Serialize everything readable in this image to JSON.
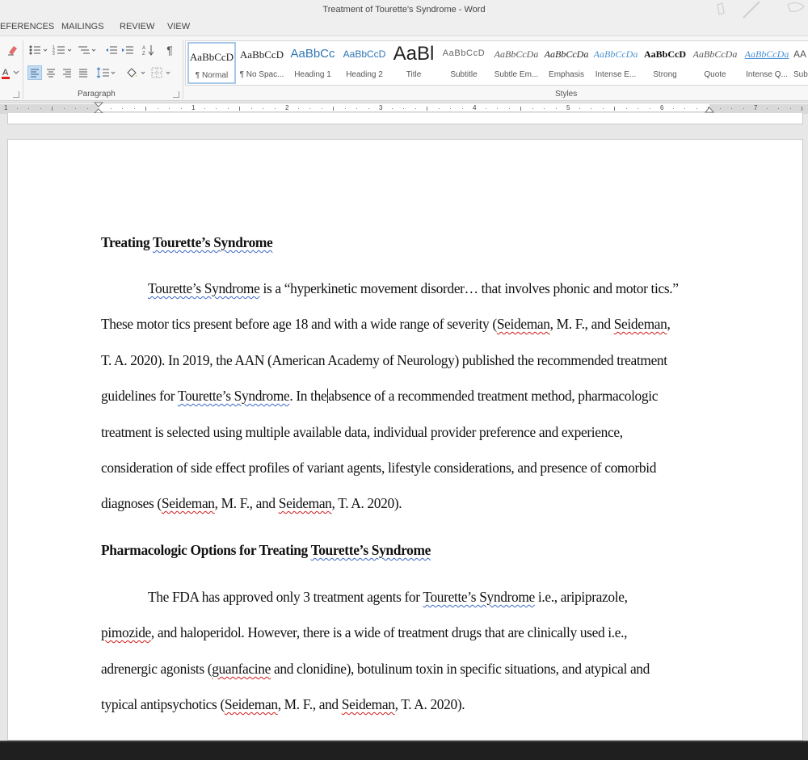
{
  "window": {
    "title": "Treatment of Tourette's Syndrome - Word"
  },
  "tabs": [
    "EFERENCES",
    "MAILINGS",
    "REVIEW",
    "VIEW"
  ],
  "ribbon": {
    "paragraph_label": "Paragraph",
    "styles_label": "Styles",
    "styles": [
      {
        "preview": "AaBbCcD",
        "name": "¶ Normal"
      },
      {
        "preview": "AaBbCcD",
        "name": "¶ No Spac..."
      },
      {
        "preview": "AaBbCc",
        "name": "Heading 1"
      },
      {
        "preview": "AaBbCcD",
        "name": "Heading 2"
      },
      {
        "preview": "AaBl",
        "name": "Title"
      },
      {
        "preview": "AaBbCcD",
        "name": "Subtitle"
      },
      {
        "preview": "AaBbCcDa",
        "name": "Subtle Em..."
      },
      {
        "preview": "AaBbCcDa",
        "name": "Emphasis"
      },
      {
        "preview": "AaBbCcDa",
        "name": "Intense E..."
      },
      {
        "preview": "AaBbCcD",
        "name": "Strong"
      },
      {
        "preview": "AaBbCcDa",
        "name": "Quote"
      },
      {
        "preview": "AaBbCcDa",
        "name": "Intense Q..."
      },
      {
        "preview": "AA",
        "name": "Sub"
      }
    ]
  },
  "ruler": {
    "numbers": [
      "1",
      "1",
      "2",
      "3",
      "4",
      "5",
      "6",
      "7"
    ]
  },
  "document": {
    "heading1": {
      "a": "Treating ",
      "b": "Tourette’s Syndrome"
    },
    "p1": {
      "l1": {
        "a": "Tourette’s Syndrome",
        "b": " is a “hyperkinetic movement disorder… that involves phonic and motor tics.”"
      },
      "l2": {
        "a": "These motor tics present before age 18 and with a wide range of severity (",
        "b": "Seideman",
        "c": ", M. F., and ",
        "d": "Seideman",
        "e": ","
      },
      "l3": "T. A. 2020). In 2019, the AAN (American Academy of Neurology) published the recommended treatment",
      "l4": {
        "a": "guidelines for ",
        "b": "Tourette’s Syndrome",
        "c": ". In the",
        "d": "absence of a recommended treatment method, pharmacologic"
      },
      "l5": "treatment is selected using multiple available data, individual provider preference and experience,",
      "l6": "consideration of side effect profiles of variant agents, lifestyle considerations, and presence of comorbid",
      "l7": {
        "a": "diagnoses (",
        "b": "Seideman",
        "c": ", M. F., and ",
        "d": "Seideman",
        "e": ", T. A. 2020)."
      }
    },
    "heading2": {
      "a": "Pharmacologic Options for Treating ",
      "b": "Tourette’s Syndrome"
    },
    "p2": {
      "l1": {
        "a": "The FDA has approved only 3 treatment agents for ",
        "b": "Tourette’s Syndrome",
        "c": " i.e., aripiprazole,"
      },
      "l2": {
        "a": "pimozide",
        "b": ", and haloperidol. However, there is a wide of treatment drugs that are clinically used i.e.,"
      },
      "l3": {
        "a": "adrenergic agonists (",
        "b": "guanfacine",
        "c": " and clonidine), botulinum toxin in specific situations, and atypical and"
      },
      "l4": {
        "a": "typical antipsychotics (",
        "b": "Seideman",
        "c": ", M. F., and ",
        "d": "Seideman",
        "e": ", T. A. 2020)."
      }
    }
  },
  "colors": {
    "squiggle_blue": "#3b67c6",
    "squiggle_red": "#d11a1a",
    "ribbon_bg": "#f7f7f7"
  }
}
